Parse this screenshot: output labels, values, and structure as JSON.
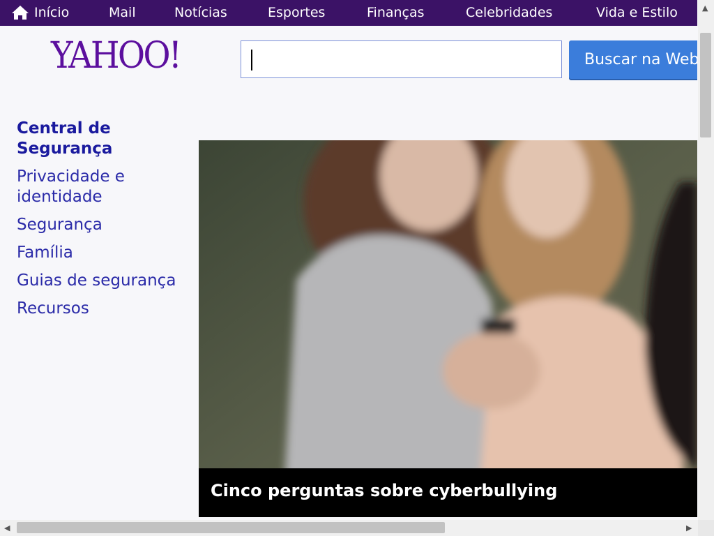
{
  "topnav": {
    "items": [
      {
        "label": "Início",
        "icon": "home-icon"
      },
      {
        "label": "Mail"
      },
      {
        "label": "Notícias"
      },
      {
        "label": "Esportes"
      },
      {
        "label": "Finanças"
      },
      {
        "label": "Celebridades"
      },
      {
        "label": "Vida e Estilo"
      }
    ],
    "background": "#3b1266"
  },
  "header": {
    "logo_text": "YAHOO!",
    "search_value": "",
    "search_button_label": "Buscar na Web",
    "brand_color": "#5c0f9e",
    "button_color": "#3b7ddb"
  },
  "sidebar": {
    "items": [
      {
        "label": "Central de Segurança",
        "active": true
      },
      {
        "label": "Privacidade e identidade"
      },
      {
        "label": "Segurança"
      },
      {
        "label": "Família"
      },
      {
        "label": "Guias de segurança"
      },
      {
        "label": "Recursos"
      }
    ]
  },
  "hero": {
    "caption": "Cinco perguntas sobre cyberbullying"
  }
}
